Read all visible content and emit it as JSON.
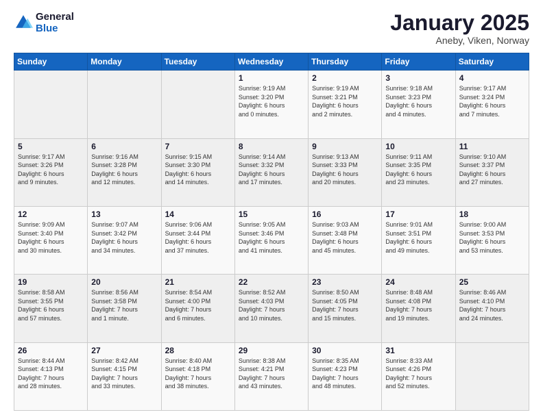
{
  "logo": {
    "line1": "General",
    "line2": "Blue"
  },
  "title": "January 2025",
  "subtitle": "Aneby, Viken, Norway",
  "days_header": [
    "Sunday",
    "Monday",
    "Tuesday",
    "Wednesday",
    "Thursday",
    "Friday",
    "Saturday"
  ],
  "weeks": [
    [
      {
        "num": "",
        "info": ""
      },
      {
        "num": "",
        "info": ""
      },
      {
        "num": "",
        "info": ""
      },
      {
        "num": "1",
        "info": "Sunrise: 9:19 AM\nSunset: 3:20 PM\nDaylight: 6 hours\nand 0 minutes."
      },
      {
        "num": "2",
        "info": "Sunrise: 9:19 AM\nSunset: 3:21 PM\nDaylight: 6 hours\nand 2 minutes."
      },
      {
        "num": "3",
        "info": "Sunrise: 9:18 AM\nSunset: 3:23 PM\nDaylight: 6 hours\nand 4 minutes."
      },
      {
        "num": "4",
        "info": "Sunrise: 9:17 AM\nSunset: 3:24 PM\nDaylight: 6 hours\nand 7 minutes."
      }
    ],
    [
      {
        "num": "5",
        "info": "Sunrise: 9:17 AM\nSunset: 3:26 PM\nDaylight: 6 hours\nand 9 minutes."
      },
      {
        "num": "6",
        "info": "Sunrise: 9:16 AM\nSunset: 3:28 PM\nDaylight: 6 hours\nand 12 minutes."
      },
      {
        "num": "7",
        "info": "Sunrise: 9:15 AM\nSunset: 3:30 PM\nDaylight: 6 hours\nand 14 minutes."
      },
      {
        "num": "8",
        "info": "Sunrise: 9:14 AM\nSunset: 3:32 PM\nDaylight: 6 hours\nand 17 minutes."
      },
      {
        "num": "9",
        "info": "Sunrise: 9:13 AM\nSunset: 3:33 PM\nDaylight: 6 hours\nand 20 minutes."
      },
      {
        "num": "10",
        "info": "Sunrise: 9:11 AM\nSunset: 3:35 PM\nDaylight: 6 hours\nand 23 minutes."
      },
      {
        "num": "11",
        "info": "Sunrise: 9:10 AM\nSunset: 3:37 PM\nDaylight: 6 hours\nand 27 minutes."
      }
    ],
    [
      {
        "num": "12",
        "info": "Sunrise: 9:09 AM\nSunset: 3:40 PM\nDaylight: 6 hours\nand 30 minutes."
      },
      {
        "num": "13",
        "info": "Sunrise: 9:07 AM\nSunset: 3:42 PM\nDaylight: 6 hours\nand 34 minutes."
      },
      {
        "num": "14",
        "info": "Sunrise: 9:06 AM\nSunset: 3:44 PM\nDaylight: 6 hours\nand 37 minutes."
      },
      {
        "num": "15",
        "info": "Sunrise: 9:05 AM\nSunset: 3:46 PM\nDaylight: 6 hours\nand 41 minutes."
      },
      {
        "num": "16",
        "info": "Sunrise: 9:03 AM\nSunset: 3:48 PM\nDaylight: 6 hours\nand 45 minutes."
      },
      {
        "num": "17",
        "info": "Sunrise: 9:01 AM\nSunset: 3:51 PM\nDaylight: 6 hours\nand 49 minutes."
      },
      {
        "num": "18",
        "info": "Sunrise: 9:00 AM\nSunset: 3:53 PM\nDaylight: 6 hours\nand 53 minutes."
      }
    ],
    [
      {
        "num": "19",
        "info": "Sunrise: 8:58 AM\nSunset: 3:55 PM\nDaylight: 6 hours\nand 57 minutes."
      },
      {
        "num": "20",
        "info": "Sunrise: 8:56 AM\nSunset: 3:58 PM\nDaylight: 7 hours\nand 1 minute."
      },
      {
        "num": "21",
        "info": "Sunrise: 8:54 AM\nSunset: 4:00 PM\nDaylight: 7 hours\nand 6 minutes."
      },
      {
        "num": "22",
        "info": "Sunrise: 8:52 AM\nSunset: 4:03 PM\nDaylight: 7 hours\nand 10 minutes."
      },
      {
        "num": "23",
        "info": "Sunrise: 8:50 AM\nSunset: 4:05 PM\nDaylight: 7 hours\nand 15 minutes."
      },
      {
        "num": "24",
        "info": "Sunrise: 8:48 AM\nSunset: 4:08 PM\nDaylight: 7 hours\nand 19 minutes."
      },
      {
        "num": "25",
        "info": "Sunrise: 8:46 AM\nSunset: 4:10 PM\nDaylight: 7 hours\nand 24 minutes."
      }
    ],
    [
      {
        "num": "26",
        "info": "Sunrise: 8:44 AM\nSunset: 4:13 PM\nDaylight: 7 hours\nand 28 minutes."
      },
      {
        "num": "27",
        "info": "Sunrise: 8:42 AM\nSunset: 4:15 PM\nDaylight: 7 hours\nand 33 minutes."
      },
      {
        "num": "28",
        "info": "Sunrise: 8:40 AM\nSunset: 4:18 PM\nDaylight: 7 hours\nand 38 minutes."
      },
      {
        "num": "29",
        "info": "Sunrise: 8:38 AM\nSunset: 4:21 PM\nDaylight: 7 hours\nand 43 minutes."
      },
      {
        "num": "30",
        "info": "Sunrise: 8:35 AM\nSunset: 4:23 PM\nDaylight: 7 hours\nand 48 minutes."
      },
      {
        "num": "31",
        "info": "Sunrise: 8:33 AM\nSunset: 4:26 PM\nDaylight: 7 hours\nand 52 minutes."
      },
      {
        "num": "",
        "info": ""
      }
    ]
  ]
}
